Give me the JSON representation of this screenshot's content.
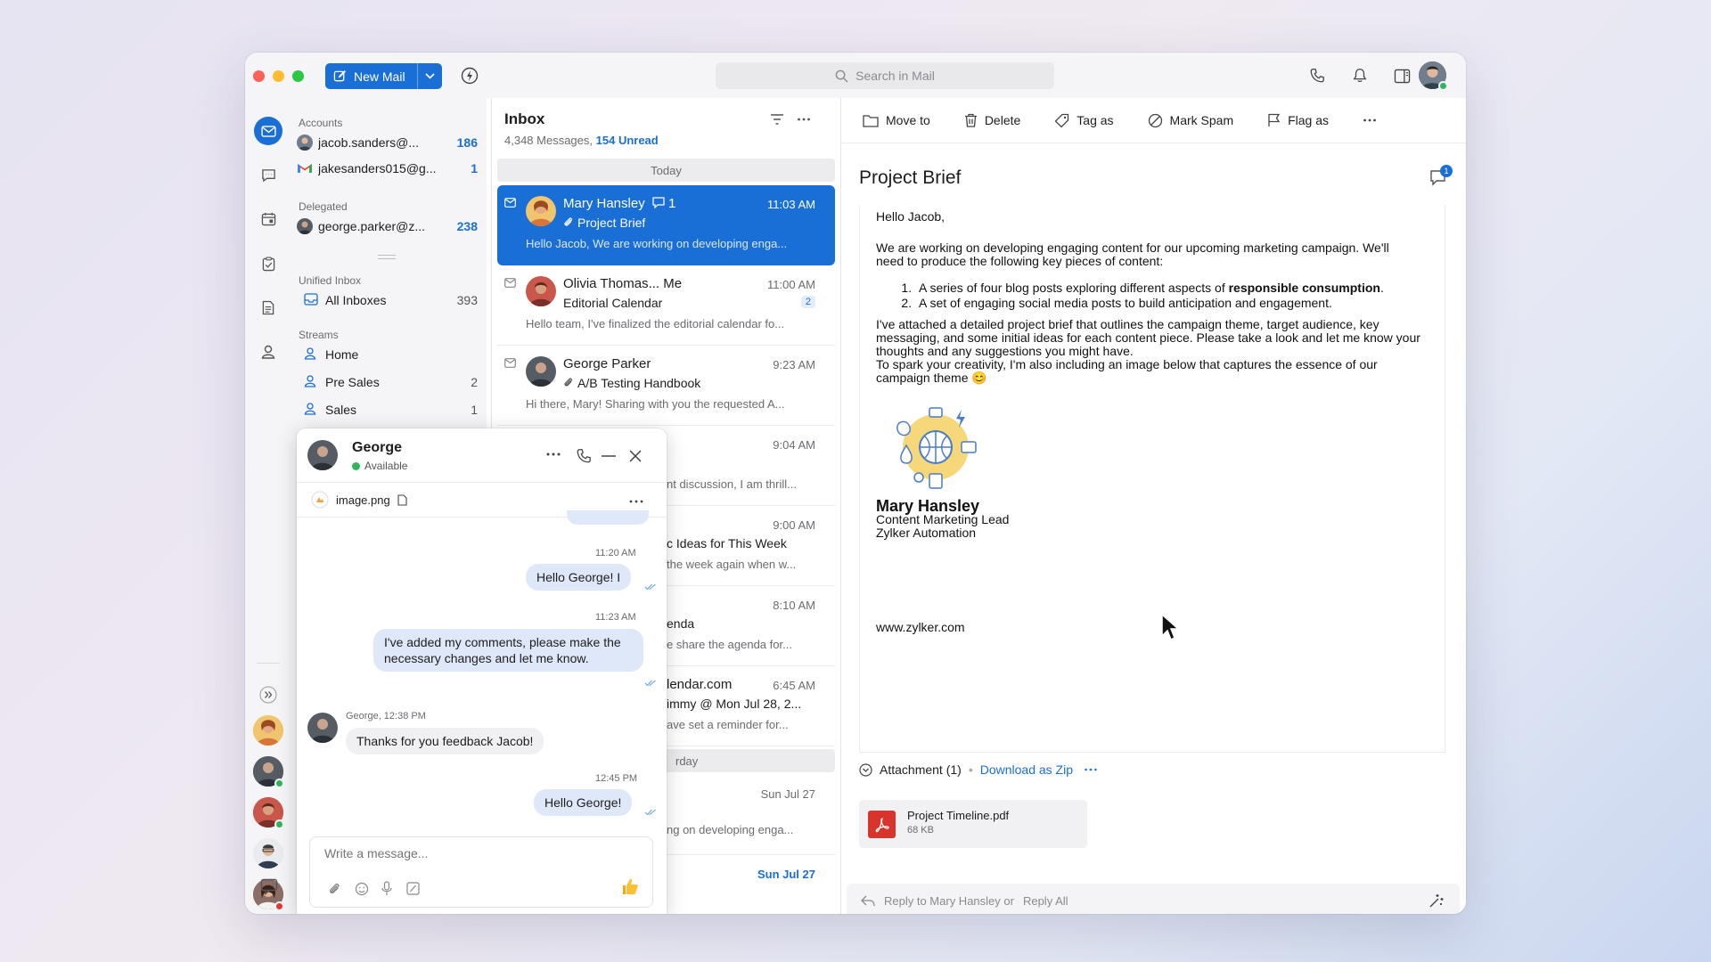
{
  "toolbar": {
    "new_mail_label": "New Mail",
    "search_placeholder": "Search in Mail"
  },
  "sidebar": {
    "accounts_header": "Accounts",
    "accounts": [
      {
        "name": "jacob.sanders@...",
        "count": "186"
      },
      {
        "name": "jakesanders015@g...",
        "count": "1"
      }
    ],
    "delegated_header": "Delegated",
    "delegated": [
      {
        "name": "george.parker@z...",
        "count": "238"
      }
    ],
    "unified_header": "Unified Inbox",
    "all_inboxes": {
      "name": "All Inboxes",
      "count": "393"
    },
    "streams_header": "Streams",
    "streams": [
      {
        "name": "Home",
        "count": ""
      },
      {
        "name": "Pre Sales",
        "count": "2"
      },
      {
        "name": "Sales",
        "count": "1"
      }
    ]
  },
  "inbox": {
    "title": "Inbox",
    "messages_count": "4,348 Messages,",
    "unread": "154 Unread",
    "today_label": "Today",
    "yesterday_label": "rday",
    "messages": [
      {
        "from": "Mary Hansley",
        "comments": "1",
        "time": "11:03 AM",
        "subject": "Project Brief",
        "preview": "Hello Jacob, We are working on developing enga..."
      },
      {
        "from": "Olivia Thomas... Me",
        "time": "11:00 AM",
        "subject": "Editorial Calendar",
        "badge": "2",
        "preview": "Hello team, I've finalized the editorial calendar fo..."
      },
      {
        "from": "George Parker",
        "time": "9:23 AM",
        "subject": "A/B Testing Handbook",
        "preview": "Hi there, Mary! Sharing with you the requested A..."
      },
      {
        "time": "9:04 AM",
        "preview": "nt discussion, I am thrill..."
      },
      {
        "time": "9:00 AM",
        "subject": "c Ideas for This Week",
        "preview": "the week again when w..."
      },
      {
        "time": "8:10 AM",
        "subject": "enda",
        "preview": "e share the agenda for..."
      },
      {
        "from": "lendar.com",
        "time": "6:45 AM",
        "subject": "immy @ Mon Jul 28, 2...",
        "preview": "ave set a reminder for..."
      },
      {
        "time": "Sun Jul 27",
        "preview": "ng on developing enga..."
      },
      {
        "time": "Sun Jul 27"
      }
    ]
  },
  "reader": {
    "actions": [
      "Move to",
      "Delete",
      "Tag as",
      "Mark Spam",
      "Flag as"
    ],
    "comment_count": "1",
    "title": "Project Brief",
    "greeting": "Hello Jacob,",
    "para1": "We are working on developing engaging content for our upcoming marketing campaign. We'll need to produce the following key pieces of content:",
    "item1_pre": "A series of four blog posts exploring different aspects of ",
    "item1_bold": "responsible consumption",
    "item1_post": ".",
    "item2": "A set of engaging social media posts to build anticipation and engagement.",
    "para2": "I've attached a detailed project brief that outlines the campaign theme, target audience, key messaging, and some initial ideas for each content piece. Please take a look and let me know your thoughts and any suggestions you might have.",
    "para3": "To spark your creativity, I'm also including an image below that captures the essence of our campaign theme 😊",
    "sig_name": "Mary Hansley",
    "sig_role": "Content Marketing Lead",
    "sig_company": "Zylker Automation",
    "website": "www.zylker.com",
    "attachment_label": "Attachment (1)",
    "download_zip": "Download as Zip",
    "file_name": "Project Timeline.pdf",
    "file_size": "68 KB",
    "reply_text": "Reply to Mary Hansley or",
    "reply_all": "Reply All"
  },
  "chat": {
    "name": "George",
    "status": "Available",
    "file": "image.png",
    "messages": [
      {
        "time": "11:20 AM",
        "text": "Hello George! I"
      },
      {
        "time": "11:23 AM",
        "text": "I've added my comments, please make the necessary changes and let me know."
      },
      {
        "sender": "George, 12:38 PM",
        "text": "Thanks for you feedback Jacob!"
      },
      {
        "time": "12:45 PM",
        "text": "Hello George!"
      }
    ],
    "input_placeholder": "Write a message..."
  },
  "colors": {
    "accent": "#1a6fd6",
    "available": "#2fb55a",
    "busy": "#e53935"
  }
}
